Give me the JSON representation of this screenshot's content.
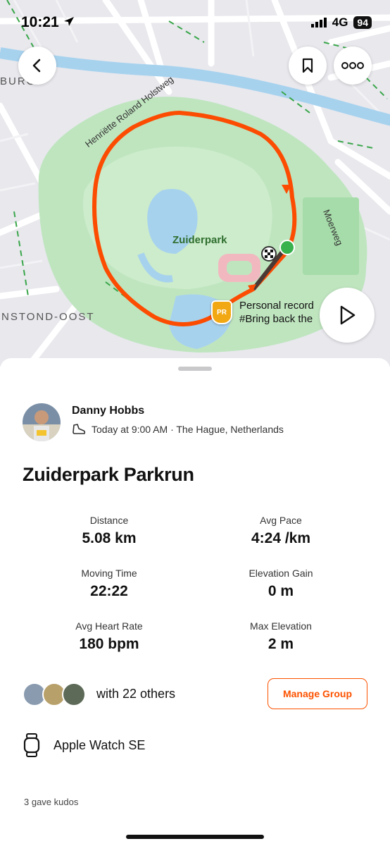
{
  "status_bar": {
    "time": "10:21",
    "network": "4G",
    "battery": "94"
  },
  "map": {
    "park_label": "Zuiderpark",
    "street_top": "Henriëtte Roland Holstweg",
    "street_right": "Moerweg",
    "district_left": "NSTOND-OOST",
    "district_top_left": "BURG",
    "pr_badge": "PR",
    "callout_line1": "Personal record",
    "callout_line2": "#Bring back the",
    "route_color": "#fc4c02"
  },
  "buttons": {
    "back": "back",
    "bookmark": "bookmark",
    "more": "more",
    "play": "play"
  },
  "activity": {
    "athlete": "Danny Hobbs",
    "meta": "Today at 9:00 AM · The Hague, Netherlands",
    "title": "Zuiderpark Parkrun"
  },
  "stats": [
    {
      "label": "Distance",
      "value": "5.08 km"
    },
    {
      "label": "Avg Pace",
      "value": "4:24 /km"
    },
    {
      "label": "Moving Time",
      "value": "22:22"
    },
    {
      "label": "Elevation Gain",
      "value": "0 m"
    },
    {
      "label": "Avg Heart Rate",
      "value": "180 bpm"
    },
    {
      "label": "Max Elevation",
      "value": "2 m"
    }
  ],
  "group": {
    "with_text": "with 22 others",
    "manage_label": "Manage Group"
  },
  "device": {
    "name": "Apple Watch SE"
  },
  "kudos": {
    "text": "3 gave kudos"
  }
}
